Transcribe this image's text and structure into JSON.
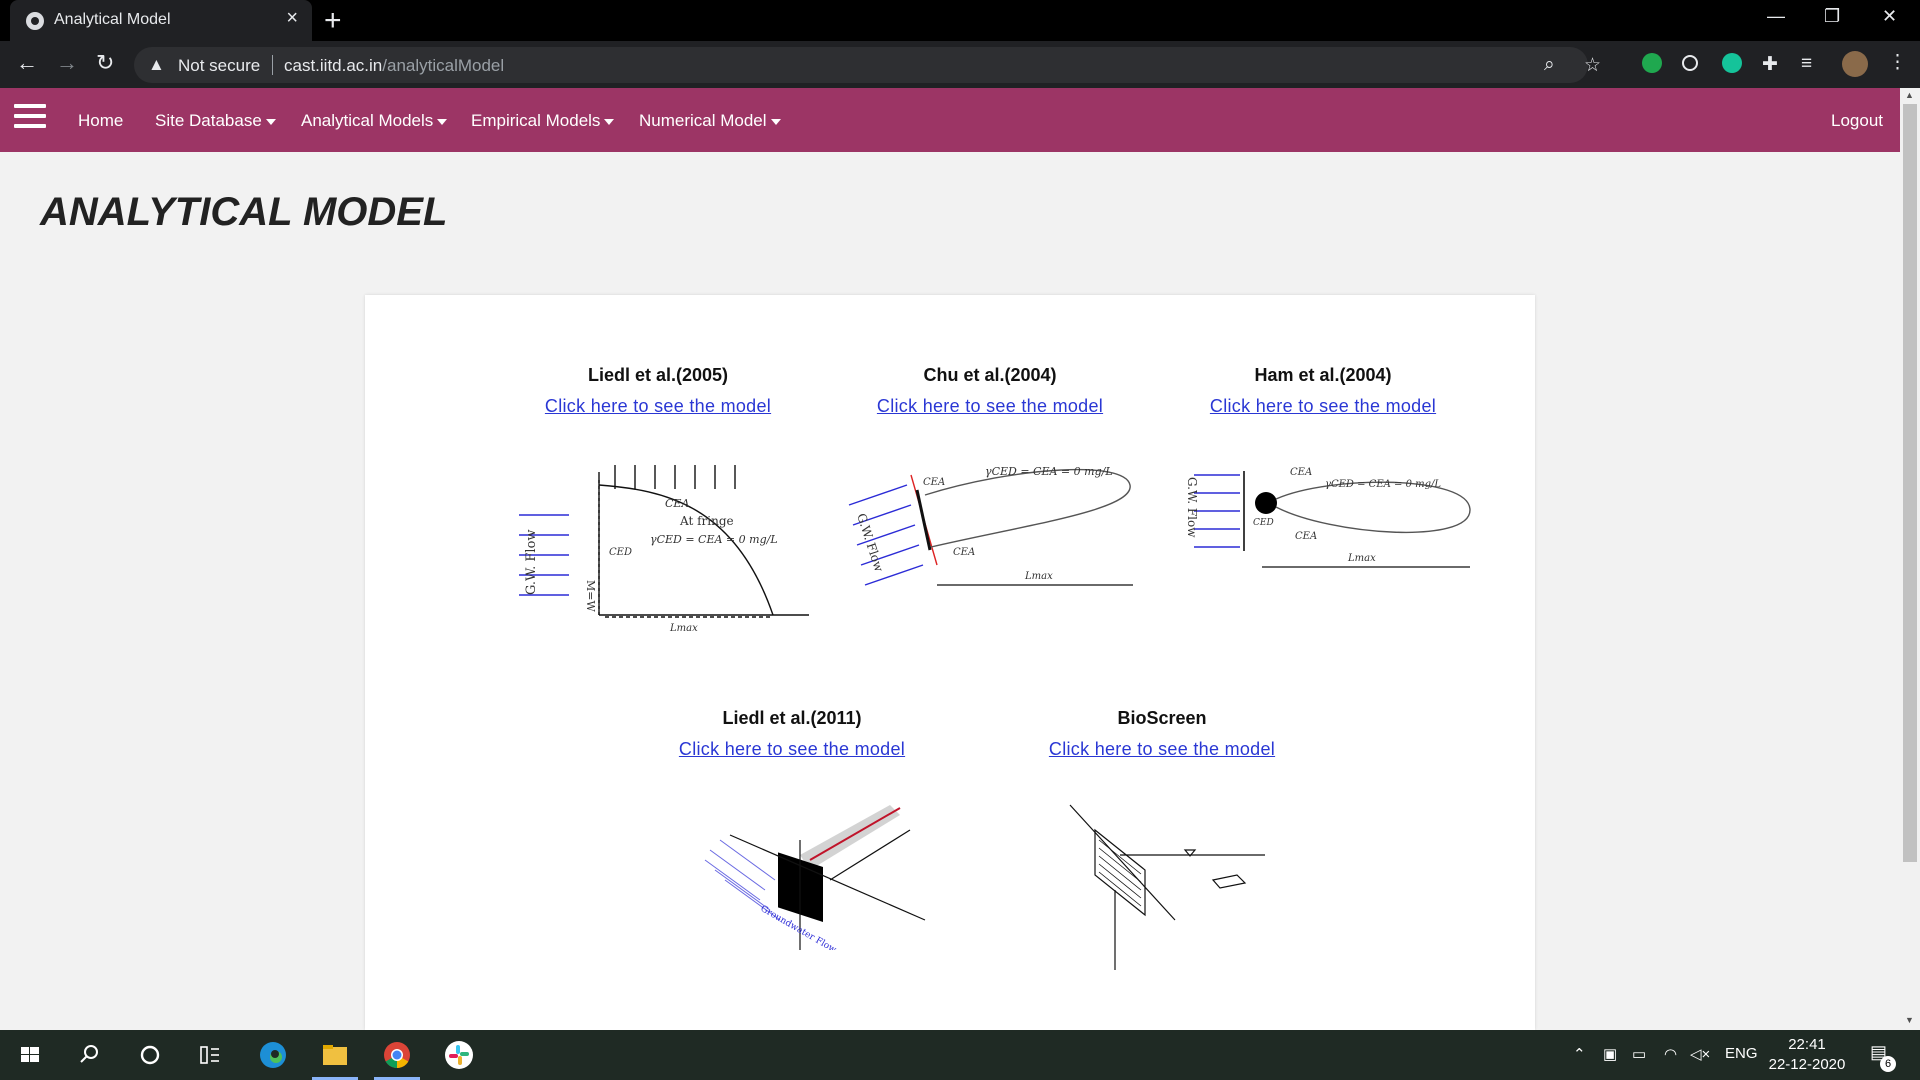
{
  "browser": {
    "tab_title": "Analytical Model",
    "new_tab": "+",
    "minimize": "—",
    "restore": "❐",
    "close_window": "✕",
    "security_label": "Not secure",
    "url_host": "cast.iitd.ac.in",
    "url_path": "/analyticalModel"
  },
  "navbar": {
    "home": "Home",
    "site_database": "Site Database",
    "analytical_models": "Analytical Models",
    "empirical_models": "Empirical Models",
    "numerical_model": "Numerical Model",
    "logout": "Logout"
  },
  "page": {
    "title": "ANALYTICAL MODEL"
  },
  "models": [
    {
      "name": "Liedl et al.(2005)",
      "link": "Click here to see the model"
    },
    {
      "name": "Chu et al.(2004)",
      "link": "Click here to see the model"
    },
    {
      "name": "Ham et al.(2004)",
      "link": "Click here to see the model"
    },
    {
      "name": "Liedl et al.(2011)",
      "link": "Click here to see the model"
    },
    {
      "name": "BioScreen",
      "link": "Click here to see the model"
    }
  ],
  "figures": {
    "gw_flow": "G.W. Flow",
    "w_label": "M=W",
    "c_ea": "CEA",
    "c_ed": "CED",
    "at_fringe": "At fringe",
    "fringe_eq": "γCED = CEA = 0 mg/L",
    "l_max": "Lmax",
    "w": "W",
    "groundwater_flow": "Groundwater Flow"
  },
  "taskbar": {
    "lang": "ENG",
    "time": "22:41",
    "date": "22-12-2020",
    "notifications": "6"
  },
  "colors": {
    "navbar": "#9c3565",
    "link": "#2a37d4",
    "taskbar": "#1f2a24"
  }
}
